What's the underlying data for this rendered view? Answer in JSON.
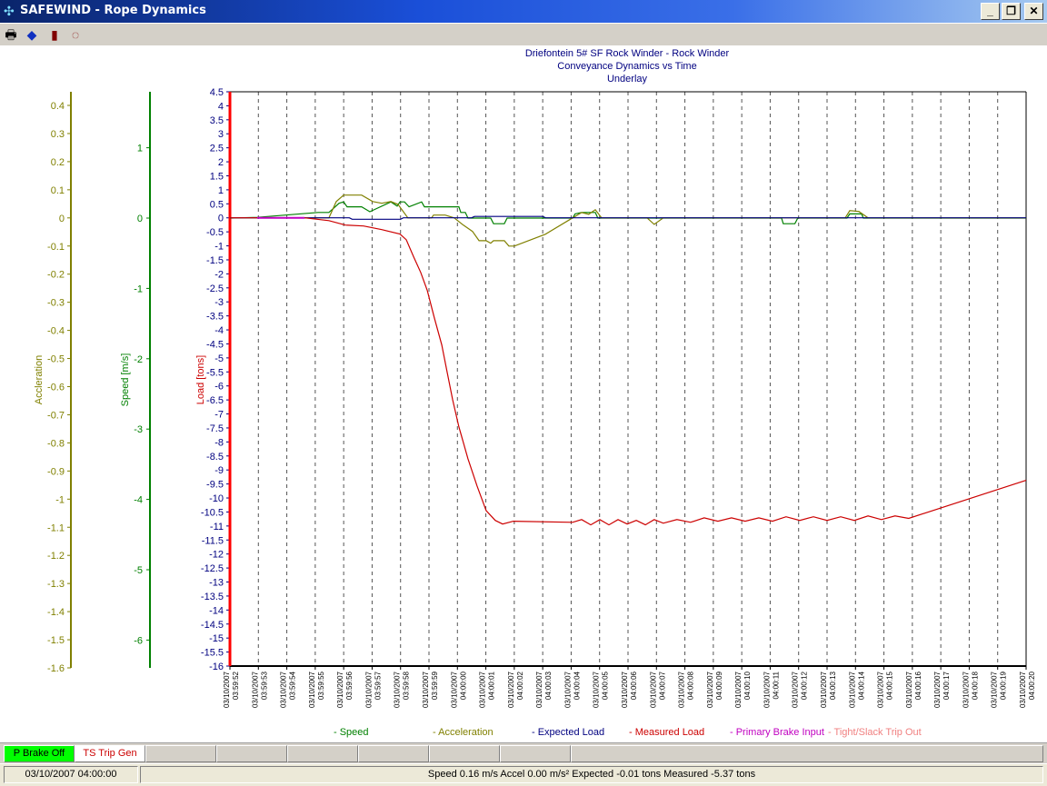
{
  "window": {
    "title": "SAFEWIND  -  Rope Dynamics",
    "app_icon": "fan-icon",
    "min": "_",
    "restore": "❐",
    "close": "✕"
  },
  "toolbar": [
    {
      "name": "print-icon",
      "glyph": "🖶"
    },
    {
      "name": "book-icon",
      "glyph": "◆"
    },
    {
      "name": "door-exit-icon",
      "glyph": "▮"
    },
    {
      "name": "settings-icon",
      "glyph": "◌"
    }
  ],
  "chart_data": {
    "type": "line",
    "title": [
      "Driefontein 5# SF Rock Winder - Rock Winder",
      "Conveyance Dynamics vs Time",
      "Underlay"
    ],
    "x_unit": "seconds since 03:59:52",
    "x_ticks": [
      [
        "03/10/2007",
        "03:59:52"
      ],
      [
        "03/10/2007",
        "03:59:53"
      ],
      [
        "03/10/2007",
        "03:59:54"
      ],
      [
        "03/10/2007",
        "03:59:55"
      ],
      [
        "03/10/2007",
        "03:59:56"
      ],
      [
        "03/10/2007",
        "03:59:57"
      ],
      [
        "03/10/2007",
        "03:59:58"
      ],
      [
        "03/10/2007",
        "03:59:59"
      ],
      [
        "03/10/2007",
        "04:00:00"
      ],
      [
        "03/10/2007",
        "04:00:01"
      ],
      [
        "03/10/2007",
        "04:00:02"
      ],
      [
        "03/10/2007",
        "04:00:03"
      ],
      [
        "03/10/2007",
        "04:00:04"
      ],
      [
        "03/10/2007",
        "04:00:05"
      ],
      [
        "03/10/2007",
        "04:00:06"
      ],
      [
        "03/10/2007",
        "04:00:07"
      ],
      [
        "03/10/2007",
        "04:00:08"
      ],
      [
        "03/10/2007",
        "04:00:09"
      ],
      [
        "03/10/2007",
        "04:00:10"
      ],
      [
        "03/10/2007",
        "04:00:11"
      ],
      [
        "03/10/2007",
        "04:00:12"
      ],
      [
        "03/10/2007",
        "04:00:13"
      ],
      [
        "03/10/2007",
        "04:00:14"
      ],
      [
        "03/10/2007",
        "04:00:15"
      ],
      [
        "03/10/2007",
        "04:00:16"
      ],
      [
        "03/10/2007",
        "04:00:17"
      ],
      [
        "03/10/2007",
        "04:00:18"
      ],
      [
        "03/10/2007",
        "04:00:19"
      ],
      [
        "03/10/2007",
        "04:00:20"
      ]
    ],
    "xlim": [
      0,
      28
    ],
    "axes": {
      "acceleration": {
        "label": "Accleration",
        "ylim": [
          -1.6,
          0.4
        ],
        "step": 0.1,
        "color": "#808000"
      },
      "speed": {
        "label": "Speed [m/s]",
        "ylim": [
          -6.2,
          1.8
        ],
        "step": 1,
        "tick_min": -6,
        "tick_max": 1,
        "color": "#008000"
      },
      "load": {
        "label": "Load [tons]",
        "ylim": [
          -16,
          4.5
        ],
        "step": 0.5,
        "color": "#cc0000",
        "tick_color": "#000080"
      }
    },
    "series": [
      {
        "name": "Speed",
        "axis": "speed",
        "color": "#008000",
        "points": [
          [
            0,
            0
          ],
          [
            0.96,
            0.01
          ],
          [
            3.1,
            0.08
          ],
          [
            3.48,
            0.08
          ],
          [
            3.84,
            0.21
          ],
          [
            4.0,
            0.23
          ],
          [
            4.12,
            0.16
          ],
          [
            4.63,
            0.16
          ],
          [
            4.92,
            0.09
          ],
          [
            5.66,
            0.23
          ],
          [
            5.88,
            0.17
          ],
          [
            5.98,
            0.23
          ],
          [
            6.14,
            0.23
          ],
          [
            6.3,
            0.16
          ],
          [
            6.74,
            0.23
          ],
          [
            6.84,
            0.16
          ],
          [
            8.05,
            0.16
          ],
          [
            8.12,
            0.08
          ],
          [
            8.28,
            0.08
          ],
          [
            8.37,
            0
          ],
          [
            9.17,
            0
          ],
          [
            9.27,
            -0.08
          ],
          [
            9.65,
            -0.08
          ],
          [
            9.75,
            0
          ],
          [
            12.05,
            0
          ],
          [
            12.14,
            0.06
          ],
          [
            12.37,
            0.08
          ],
          [
            12.85,
            0.08
          ],
          [
            12.94,
            0
          ],
          [
            19.4,
            0
          ],
          [
            19.46,
            -0.08
          ],
          [
            19.87,
            -0.08
          ],
          [
            19.97,
            0
          ],
          [
            21.7,
            0
          ],
          [
            21.8,
            0.06
          ],
          [
            22.21,
            0.06
          ],
          [
            22.28,
            0
          ],
          [
            28,
            0
          ]
        ]
      },
      {
        "name": "Acceleration",
        "axis": "acceleration",
        "color": "#808000",
        "points": [
          [
            0,
            0
          ],
          [
            3.48,
            0
          ],
          [
            3.74,
            0.058
          ],
          [
            4.0,
            0.081
          ],
          [
            4.63,
            0.081
          ],
          [
            5.02,
            0.058
          ],
          [
            5.34,
            0.052
          ],
          [
            5.66,
            0.058
          ],
          [
            5.91,
            0.048
          ],
          [
            6.26,
            0
          ],
          [
            7.09,
            0
          ],
          [
            7.16,
            0.01
          ],
          [
            7.57,
            0.01
          ],
          [
            7.89,
            0
          ],
          [
            8.21,
            -0.026
          ],
          [
            8.53,
            -0.048
          ],
          [
            8.76,
            -0.081
          ],
          [
            9.01,
            -0.081
          ],
          [
            9.17,
            -0.09
          ],
          [
            9.27,
            -0.081
          ],
          [
            9.65,
            -0.081
          ],
          [
            9.81,
            -0.1
          ],
          [
            10.0,
            -0.1
          ],
          [
            11.09,
            -0.058
          ],
          [
            12.05,
            0
          ],
          [
            12.37,
            0.019
          ],
          [
            12.62,
            0.013
          ],
          [
            12.85,
            0.029
          ],
          [
            13.07,
            0
          ],
          [
            14.67,
            0
          ],
          [
            14.92,
            -0.023
          ],
          [
            15.24,
            0
          ],
          [
            21.64,
            0
          ],
          [
            21.8,
            0.026
          ],
          [
            22.12,
            0.023
          ],
          [
            22.44,
            0
          ],
          [
            28,
            0
          ]
        ]
      },
      {
        "name": "Expected Load",
        "axis": "load",
        "color": "#000080",
        "points": [
          [
            0,
            0
          ],
          [
            4.2,
            0
          ],
          [
            4.3,
            -0.05
          ],
          [
            6.0,
            -0.05
          ],
          [
            6.1,
            0
          ],
          [
            8.5,
            0
          ],
          [
            8.6,
            0.05
          ],
          [
            11.0,
            0.05
          ],
          [
            11.1,
            0
          ],
          [
            28,
            0
          ]
        ]
      },
      {
        "name": "Measured Load",
        "axis": "load",
        "color": "#cc0000",
        "points": [
          [
            0,
            0
          ],
          [
            2.62,
            0
          ],
          [
            3.48,
            -0.1
          ],
          [
            4.06,
            -0.26
          ],
          [
            4.7,
            -0.29
          ],
          [
            5.34,
            -0.42
          ],
          [
            5.98,
            -0.58
          ],
          [
            6.2,
            -0.78
          ],
          [
            6.46,
            -1.39
          ],
          [
            6.71,
            -1.95
          ],
          [
            6.94,
            -2.59
          ],
          [
            7.19,
            -3.57
          ],
          [
            7.45,
            -4.54
          ],
          [
            7.64,
            -5.51
          ],
          [
            7.83,
            -6.49
          ],
          [
            8.05,
            -7.46
          ],
          [
            8.37,
            -8.6
          ],
          [
            8.69,
            -9.57
          ],
          [
            9.01,
            -10.45
          ],
          [
            9.33,
            -10.8
          ],
          [
            9.59,
            -10.93
          ],
          [
            9.97,
            -10.83
          ],
          [
            12.05,
            -10.87
          ],
          [
            12.37,
            -10.77
          ],
          [
            12.69,
            -10.96
          ],
          [
            13.01,
            -10.77
          ],
          [
            13.33,
            -10.96
          ],
          [
            13.65,
            -10.77
          ],
          [
            13.97,
            -10.93
          ],
          [
            14.29,
            -10.8
          ],
          [
            14.61,
            -10.96
          ],
          [
            14.92,
            -10.77
          ],
          [
            15.24,
            -10.9
          ],
          [
            15.72,
            -10.77
          ],
          [
            16.2,
            -10.87
          ],
          [
            16.68,
            -10.71
          ],
          [
            17.16,
            -10.83
          ],
          [
            17.64,
            -10.71
          ],
          [
            18.12,
            -10.83
          ],
          [
            18.6,
            -10.71
          ],
          [
            19.08,
            -10.83
          ],
          [
            19.56,
            -10.67
          ],
          [
            20.04,
            -10.8
          ],
          [
            20.52,
            -10.67
          ],
          [
            21.0,
            -10.8
          ],
          [
            21.48,
            -10.67
          ],
          [
            21.96,
            -10.8
          ],
          [
            22.44,
            -10.64
          ],
          [
            22.91,
            -10.77
          ],
          [
            23.39,
            -10.64
          ],
          [
            23.87,
            -10.73
          ],
          [
            28,
            -9.37
          ]
        ]
      },
      {
        "name": "Primary Brake Input",
        "axis": "load",
        "color": "#c000c0",
        "points": [
          [
            0.96,
            0
          ],
          [
            2.62,
            0
          ]
        ]
      },
      {
        "name": "Tight/Slack Trip Out",
        "axis": "load",
        "color": "#f08080",
        "points": []
      }
    ],
    "legend": [
      {
        "label": "- Speed",
        "color": "#008000"
      },
      {
        "label": "- Acceleration",
        "color": "#808000"
      },
      {
        "label": "- Expected Load",
        "color": "#000080"
      },
      {
        "label": "- Measured Load",
        "color": "#cc0000"
      },
      {
        "label": "- Primary Brake Input",
        "color": "#c000c0"
      },
      {
        "label": "- Tight/Slack Trip Out",
        "color": "#f08080"
      }
    ],
    "legend_position": "bottom",
    "grid": "vertical dashed"
  },
  "indicators": [
    {
      "label": "P Brake Off",
      "bg": "#00ff00",
      "color": "#000000"
    },
    {
      "label": "TS Trip Gen",
      "bg": "#ffffff",
      "color": "#cc0000"
    }
  ],
  "status": {
    "datetime": "03/10/2007 04:00:00",
    "readout": "Speed 0.16 m/s  Accel 0.00 m/s²  Expected -0.01 tons  Measured -5.37 tons"
  }
}
